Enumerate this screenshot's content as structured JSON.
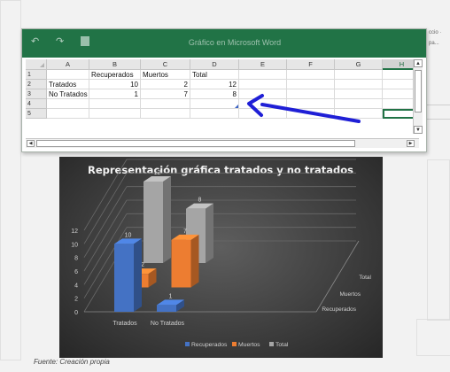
{
  "window": {
    "title": "Gráfico en Microsoft Word",
    "qa_icons": [
      "undo-icon",
      "redo-icon",
      "excel-sheet-icon"
    ]
  },
  "background": {
    "edge_text": [
      "ccio ·",
      "pa..."
    ]
  },
  "sheet": {
    "columns": [
      "A",
      "B",
      "C",
      "D",
      "E",
      "F",
      "G",
      "H"
    ],
    "selected_column": "H",
    "row_numbers": [
      "1",
      "2",
      "3",
      "4",
      "5"
    ],
    "rows": [
      [
        "",
        "Recuperados",
        "Muertos",
        "Total",
        "",
        "",
        "",
        ""
      ],
      [
        "Tratados",
        "10",
        "2",
        "12",
        "",
        "",
        "",
        ""
      ],
      [
        "No Tratados",
        "1",
        "7",
        "8",
        "",
        "",
        "",
        ""
      ],
      [
        "",
        "",
        "",
        "",
        "",
        "",
        "",
        ""
      ],
      [
        "",
        "",
        "",
        "",
        "",
        "",
        "",
        ""
      ]
    ]
  },
  "annotation": {
    "arrow_color": "#1f1fd6"
  },
  "chart_data": {
    "type": "bar",
    "title": "Representación gráfica tratados y no tratados",
    "categories": [
      "Tratados",
      "No Tratados"
    ],
    "series": [
      {
        "name": "Recuperados",
        "values": [
          10,
          1
        ],
        "color": "#4472c4"
      },
      {
        "name": "Muertos",
        "values": [
          2,
          7
        ],
        "color": "#ed7d31"
      },
      {
        "name": "Total",
        "values": [
          12,
          8
        ],
        "color": "#a5a5a5"
      }
    ],
    "ylim": [
      0,
      12
    ],
    "yticks": [
      "0",
      "2",
      "4",
      "6",
      "8",
      "10",
      "12"
    ],
    "depth_labels": [
      "Total",
      "Muertos",
      "Recuperados"
    ],
    "legend_position": "bottom",
    "grid": true,
    "background": "#404040"
  },
  "caption": {
    "text": "Fuente: Creación propia"
  }
}
